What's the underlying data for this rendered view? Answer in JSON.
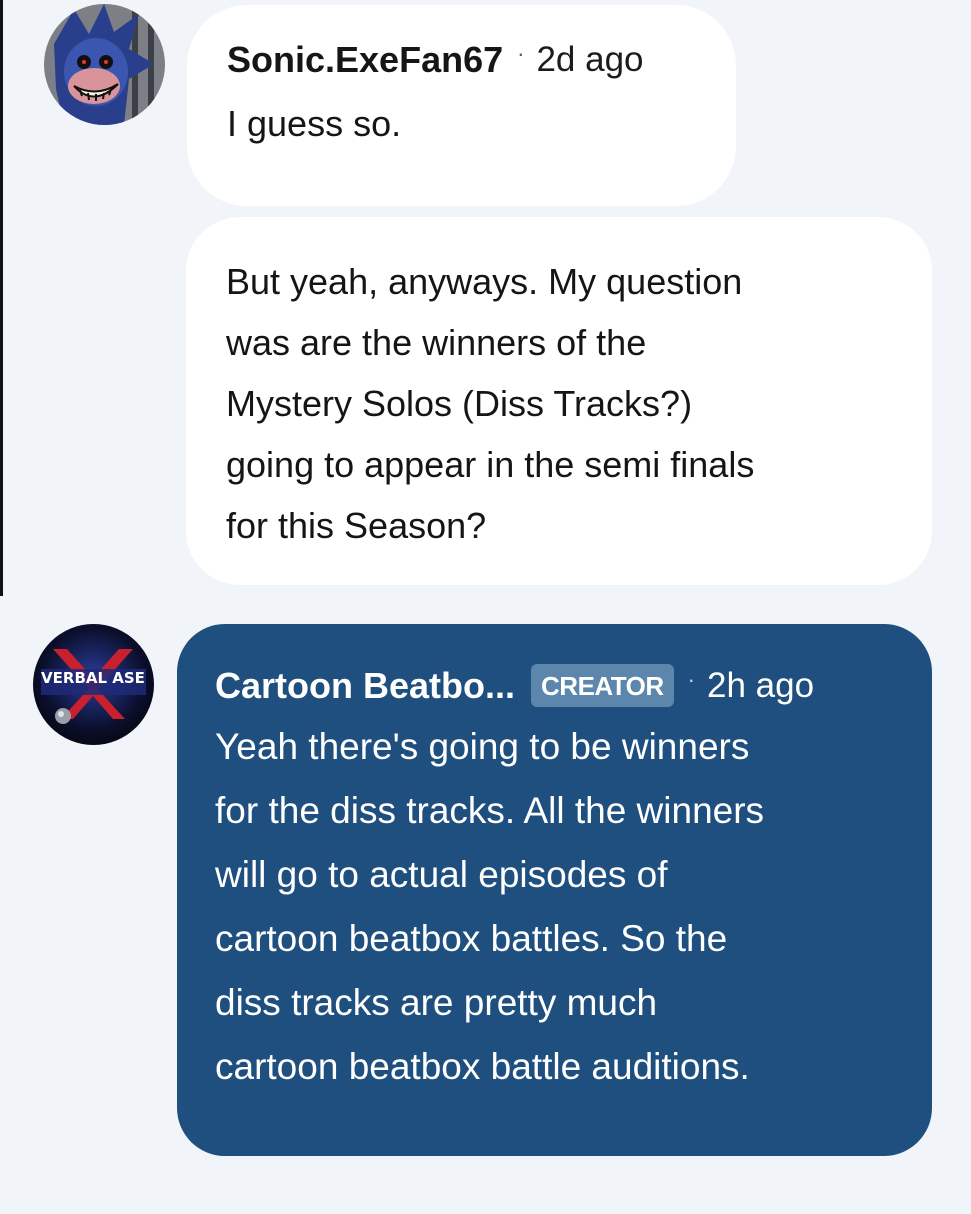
{
  "comments": [
    {
      "author": "Sonic.ExeFan67",
      "separator": "·",
      "time": "2d ago",
      "text_lines": [
        "I guess so."
      ]
    },
    {
      "text_lines": [
        "But yeah, anyways. My question",
        "was are the winners of the",
        "Mystery Solos (Diss Tracks?)",
        "going to appear in the semi finals",
        "for this Season?"
      ]
    },
    {
      "author": "Cartoon Beatbo...",
      "badge": "CREATOR",
      "separator": "·",
      "time": "2h ago",
      "avatar_logo_text": "VERBAL ASE",
      "text_lines": [
        "Yeah there's going to be winners",
        "for the diss tracks. All the winners",
        "will go to actual episodes of",
        "cartoon beatbox battles. So the",
        "diss tracks are pretty much",
        "cartoon beatbox battle auditions."
      ]
    }
  ],
  "colors": {
    "page_background": "#f1f5fa",
    "user_bubble": "#ffffff",
    "creator_bubble": "#1e4f7f",
    "creator_badge": "#5d86ad"
  },
  "icons": {
    "avatar_1": "sonic-exe-avatar",
    "avatar_2": "verbal-ase-logo-avatar"
  }
}
